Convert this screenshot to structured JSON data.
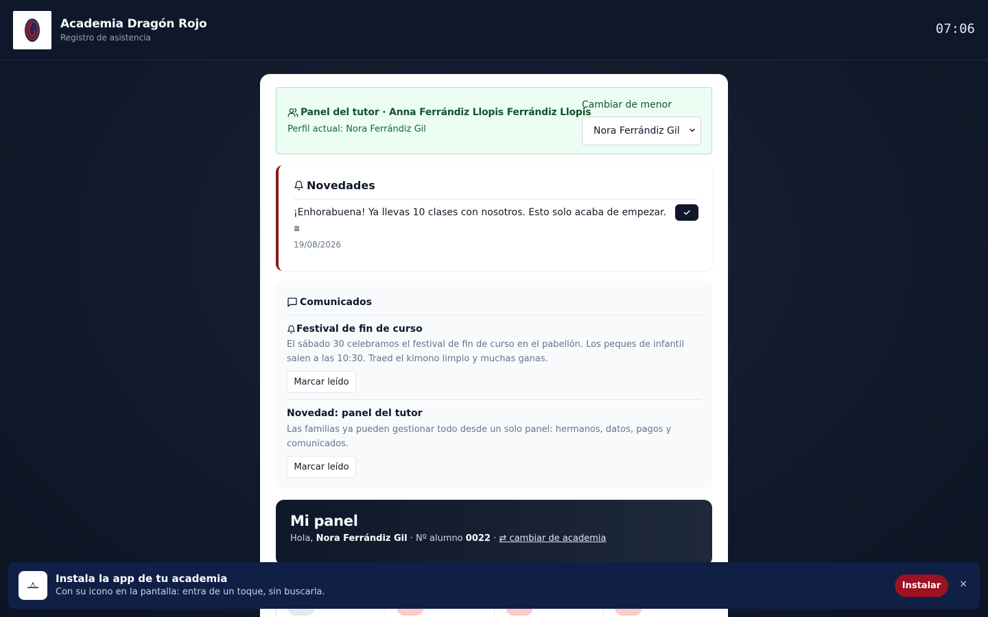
{
  "header": {
    "brand_name": "Academia Dragón Rojo",
    "brand_sub": "Registro de asistencia",
    "clock": "07:06"
  },
  "tutor": {
    "title": "Panel del tutor · Anna Ferrándiz Llopis Ferrándiz Llopis",
    "current_profile": "Perfil actual: Nora Ferrándiz Gil",
    "switch_label": "Cambiar de menor",
    "selected_minor": "Nora Ferrándiz Gil"
  },
  "news": {
    "heading": "Novedades",
    "message": "¡Enhorabuena! Ya llevas 10 clases con nosotros. Esto solo acaba de empezar.",
    "extra": "≣",
    "date": "19/08/2026"
  },
  "communications": {
    "heading": "Comunicados",
    "items": [
      {
        "title": "Festival de fin de curso",
        "body": "El sábado 30 celebramos el festival de fin de curso en el pabellón. Los peques de infantil salen a las 10:30. Traed el kimono limpio y muchas ganas.",
        "button": "Marcar leído"
      },
      {
        "title": "Novedad: panel del tutor",
        "body": "Las familias ya pueden gestionar todo desde un solo panel: hermanos, datos, pagos y comunicados.",
        "button": "Marcar leído"
      }
    ]
  },
  "panel": {
    "title": "Mi panel",
    "greeting": "Hola,",
    "student_name": "Nora Ferrándiz Gil",
    "student_label": "· Nº alumno",
    "student_number": "0022",
    "separator": "·",
    "switch_link": "⇄ cambiar de academia"
  },
  "install_banner": {
    "title": "Instala la app de tu academia",
    "subtitle": "Con su icono en la pantalla: entra de un toque, sin buscarla.",
    "button": "Instalar",
    "close": "×"
  },
  "colors": {
    "brand_red": "#9b1222",
    "navy": "#0f172a",
    "tutor_green_bg": "#ecfdf3"
  }
}
